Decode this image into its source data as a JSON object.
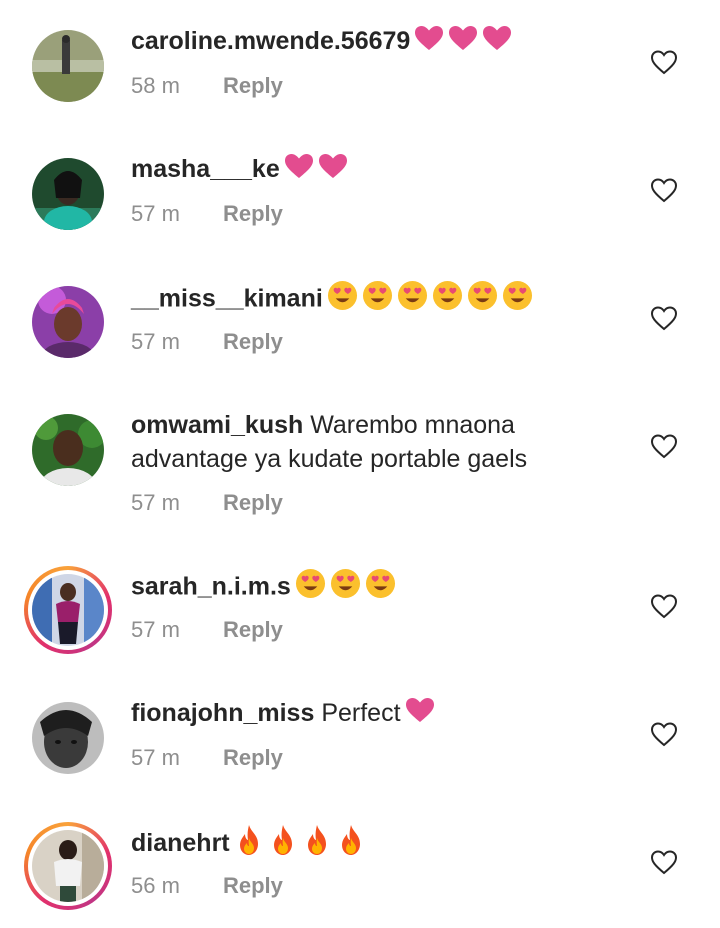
{
  "reply_label": "Reply",
  "colors": {
    "text": "#262626",
    "meta": "#8e8e8e",
    "heart": "#e34c8f"
  },
  "comments": [
    {
      "username": "caroline.mwende.56679",
      "message": "",
      "emojis": [
        "pink-heart",
        "pink-heart",
        "pink-heart"
      ],
      "time": "58 m",
      "story_ring": false
    },
    {
      "username": "masha___ke",
      "message": "",
      "emojis": [
        "pink-heart",
        "pink-heart"
      ],
      "time": "57 m",
      "story_ring": false
    },
    {
      "username": "__miss__kimani",
      "message": "",
      "emojis": [
        "heart-eyes",
        "heart-eyes",
        "heart-eyes",
        "heart-eyes",
        "heart-eyes",
        "heart-eyes"
      ],
      "time": "57 m",
      "story_ring": false
    },
    {
      "username": "omwami_kush",
      "message": "Warembo mnaona advantage ya kudate portable gaels",
      "emojis": [],
      "time": "57 m",
      "story_ring": false
    },
    {
      "username": "sarah_n.i.m.s",
      "message": "",
      "emojis": [
        "heart-eyes",
        "heart-eyes",
        "heart-eyes"
      ],
      "time": "57 m",
      "story_ring": true
    },
    {
      "username": "fionajohn_miss",
      "message": "Perfect",
      "emojis": [
        "pink-heart"
      ],
      "time": "57 m",
      "story_ring": false
    },
    {
      "username": "dianehrt",
      "message": "",
      "emojis": [
        "fire",
        "fire",
        "fire",
        "fire"
      ],
      "time": "56 m",
      "story_ring": true
    }
  ]
}
